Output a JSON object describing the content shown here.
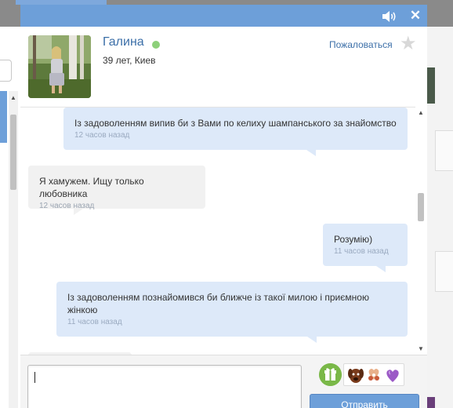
{
  "profile": {
    "name": "Галина",
    "details": "39 лет, Киев",
    "report_label": "Пожаловаться",
    "online_color": "#8dd07a"
  },
  "messages": [
    {
      "direction": "out",
      "text": "Із задоволенням випив би з Вами по келиху шампанського за знайомство",
      "time": "12 часов назад"
    },
    {
      "direction": "in",
      "text": "Я хамужем. Ищу только любовника",
      "time": "12 часов назад"
    },
    {
      "direction": "out",
      "text": "Розумію)",
      "time": "11 часов назад"
    },
    {
      "direction": "out",
      "text": "Із задоволенням познайомився би ближче із такої милою і приємною жінкою",
      "time": "11 часов назад"
    }
  ],
  "composer": {
    "message_value": "",
    "send_label": "Отправить"
  },
  "icons": {
    "titlebar": [
      "speaker-icon",
      "close-icon"
    ],
    "profile": [
      "online-status-icon",
      "favorite-star-icon"
    ],
    "composer": [
      "gift-icon",
      "sticker-puppy-icon",
      "sticker-hearts-icon",
      "sticker-heart-icon"
    ]
  },
  "colors": {
    "accent": "#6d9fd9",
    "outgoing_bubble": "#dde9f9",
    "incoming_bubble": "#f1f1f1",
    "link": "#3c6fa8"
  }
}
